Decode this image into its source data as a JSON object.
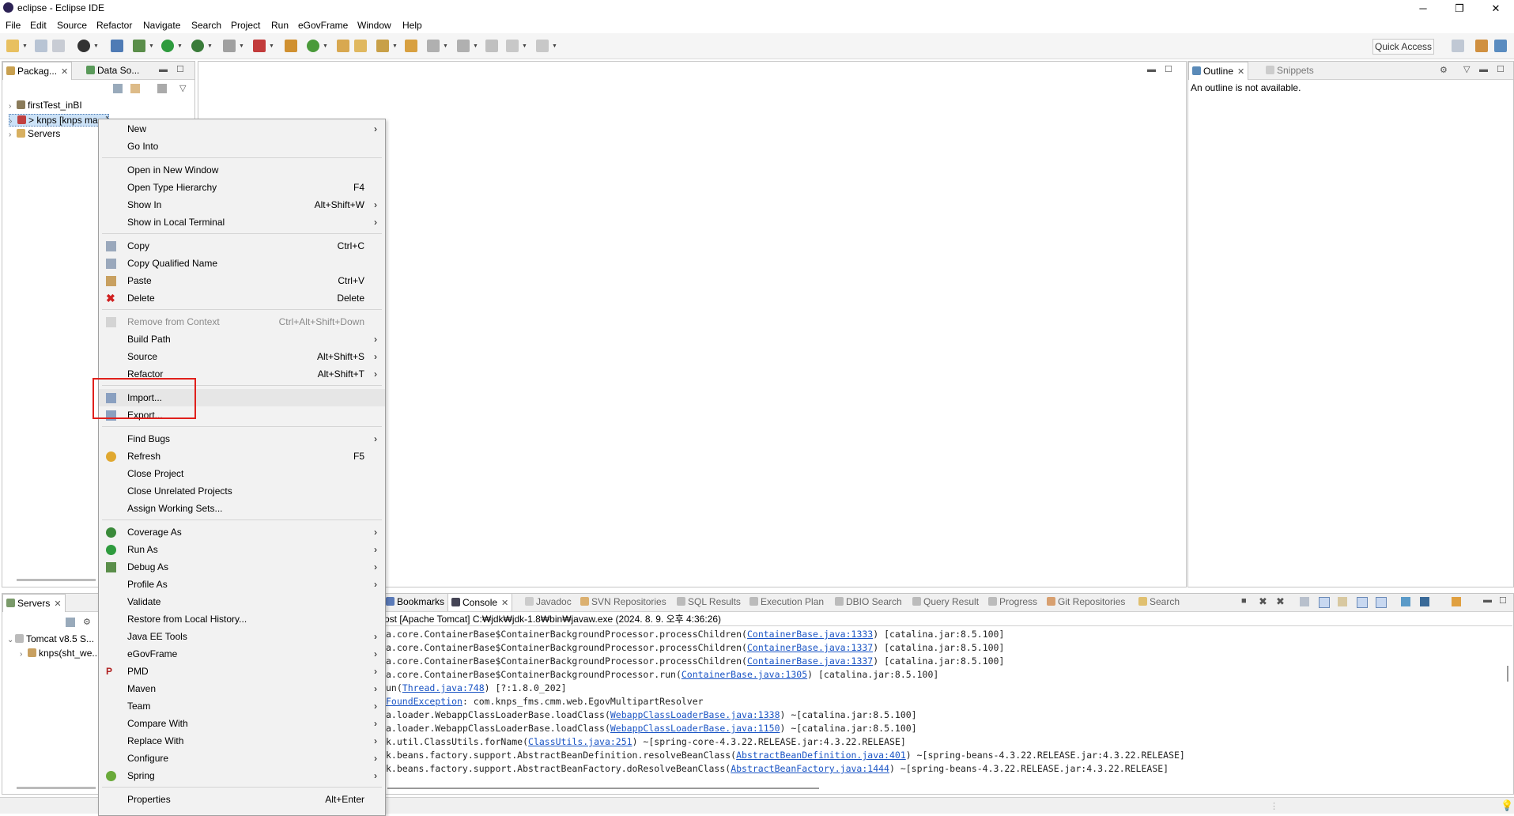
{
  "window": {
    "title": "eclipse - Eclipse IDE",
    "controls": [
      "─",
      "❐",
      "✕"
    ]
  },
  "menubar": [
    "File",
    "Edit",
    "Source",
    "Refactor",
    "Navigate",
    "Search",
    "Project",
    "Run",
    "eGovFrame",
    "Window",
    "Help"
  ],
  "toolbar": {
    "quick_access": "Quick Access"
  },
  "left_panel": {
    "tabs": [
      "Packag...",
      "Data So..."
    ],
    "tree": [
      "firstTest_inBI",
      "> knps [knps ma...]",
      "Servers"
    ]
  },
  "outline": {
    "tabs": [
      "Outline",
      "Snippets"
    ],
    "message": "An outline is not available."
  },
  "servers_panel": {
    "tab": "Servers",
    "tree": [
      "Tomcat v8.5 S...",
      "knps(sht_we..."
    ]
  },
  "bottom_tabs": [
    "Bookmarks",
    "Console",
    "Javadoc",
    "SVN Repositories",
    "SQL Results",
    "Execution Plan",
    "DBIO Search",
    "Query Result",
    "Progress",
    "Git Repositories",
    "Search"
  ],
  "console": {
    "header": "ost [Apache Tomcat] C:₩jdk₩jdk-1.8₩bin₩javaw.exe (2024. 8. 9. 오후 4:36:26)",
    "lines": [
      {
        "pre": "a.core.ContainerBase$ContainerBackgroundProcessor.processChildren(",
        "link": "ContainerBase.java:1333",
        "post": ") [catalina.jar:8.5.100]"
      },
      {
        "pre": "a.core.ContainerBase$ContainerBackgroundProcessor.processChildren(",
        "link": "ContainerBase.java:1337",
        "post": ") [catalina.jar:8.5.100]"
      },
      {
        "pre": "a.core.ContainerBase$ContainerBackgroundProcessor.processChildren(",
        "link": "ContainerBase.java:1337",
        "post": ") [catalina.jar:8.5.100]"
      },
      {
        "pre": "a.core.ContainerBase$ContainerBackgroundProcessor.run(",
        "link": "ContainerBase.java:1305",
        "post": ") [catalina.jar:8.5.100]"
      },
      {
        "pre": "un(",
        "link": "Thread.java:748",
        "post": ") [?:1.8.0_202]"
      },
      {
        "pre": "",
        "link": "FoundException",
        "post": ": com.knps_fms.cmm.web.EgovMultipartResolver"
      },
      {
        "pre": "a.loader.WebappClassLoaderBase.loadClass(",
        "link": "WebappClassLoaderBase.java:1338",
        "post": ") ~[catalina.jar:8.5.100]"
      },
      {
        "pre": "a.loader.WebappClassLoaderBase.loadClass(",
        "link": "WebappClassLoaderBase.java:1150",
        "post": ") ~[catalina.jar:8.5.100]"
      },
      {
        "pre": "k.util.ClassUtils.forName(",
        "link": "ClassUtils.java:251",
        "post": ") ~[spring-core-4.3.22.RELEASE.jar:4.3.22.RELEASE]"
      },
      {
        "pre": "k.beans.factory.support.AbstractBeanDefinition.resolveBeanClass(",
        "link": "AbstractBeanDefinition.java:401",
        "post": ") ~[spring-beans-4.3.22.RELEASE.jar:4.3.22.RELEASE]"
      },
      {
        "pre": "k.beans.factory.support.AbstractBeanFactory.doResolveBeanClass(",
        "link": "AbstractBeanFactory.java:1444",
        "post": ") ~[spring-beans-4.3.22.RELEASE.jar:4.3.22.RELEASE]"
      }
    ]
  },
  "context_menu": {
    "items": [
      {
        "label": "New",
        "shortcut": "",
        "submenu": true
      },
      {
        "label": "Go Into",
        "shortcut": ""
      },
      {
        "label": "Open in New Window",
        "shortcut": ""
      },
      {
        "label": "Open Type Hierarchy",
        "shortcut": "F4"
      },
      {
        "label": "Show In",
        "shortcut": "Alt+Shift+W",
        "submenu": true
      },
      {
        "label": "Show in Local Terminal",
        "shortcut": "",
        "submenu": true
      },
      {
        "label": "Copy",
        "shortcut": "Ctrl+C"
      },
      {
        "label": "Copy Qualified Name",
        "shortcut": ""
      },
      {
        "label": "Paste",
        "shortcut": "Ctrl+V"
      },
      {
        "label": "Delete",
        "shortcut": "Delete"
      },
      {
        "label": "Remove from Context",
        "shortcut": "Ctrl+Alt+Shift+Down",
        "disabled": true
      },
      {
        "label": "Build Path",
        "shortcut": "",
        "submenu": true
      },
      {
        "label": "Source",
        "shortcut": "Alt+Shift+S",
        "submenu": true
      },
      {
        "label": "Refactor",
        "shortcut": "Alt+Shift+T",
        "submenu": true
      },
      {
        "label": "Import...",
        "shortcut": ""
      },
      {
        "label": "Export...",
        "shortcut": ""
      },
      {
        "label": "Find Bugs",
        "shortcut": "",
        "submenu": true
      },
      {
        "label": "Refresh",
        "shortcut": "F5"
      },
      {
        "label": "Close Project",
        "shortcut": ""
      },
      {
        "label": "Close Unrelated Projects",
        "shortcut": ""
      },
      {
        "label": "Assign Working Sets...",
        "shortcut": ""
      },
      {
        "label": "Coverage As",
        "shortcut": "",
        "submenu": true
      },
      {
        "label": "Run As",
        "shortcut": "",
        "submenu": true
      },
      {
        "label": "Debug As",
        "shortcut": "",
        "submenu": true
      },
      {
        "label": "Profile As",
        "shortcut": "",
        "submenu": true
      },
      {
        "label": "Validate",
        "shortcut": ""
      },
      {
        "label": "Restore from Local History...",
        "shortcut": ""
      },
      {
        "label": "Java EE Tools",
        "shortcut": "",
        "submenu": true
      },
      {
        "label": "eGovFrame",
        "shortcut": "",
        "submenu": true
      },
      {
        "label": "PMD",
        "shortcut": "",
        "submenu": true
      },
      {
        "label": "Maven",
        "shortcut": "",
        "submenu": true
      },
      {
        "label": "Team",
        "shortcut": "",
        "submenu": true
      },
      {
        "label": "Compare With",
        "shortcut": "",
        "submenu": true
      },
      {
        "label": "Replace With",
        "shortcut": "",
        "submenu": true
      },
      {
        "label": "Configure",
        "shortcut": "",
        "submenu": true
      },
      {
        "label": "Spring",
        "shortcut": "",
        "submenu": true
      },
      {
        "label": "Properties",
        "shortcut": "Alt+Enter"
      }
    ]
  },
  "colors": {
    "highlight_box": "#e0201c",
    "link": "#1a54c4",
    "menu_bg": "#f2f2f2"
  }
}
